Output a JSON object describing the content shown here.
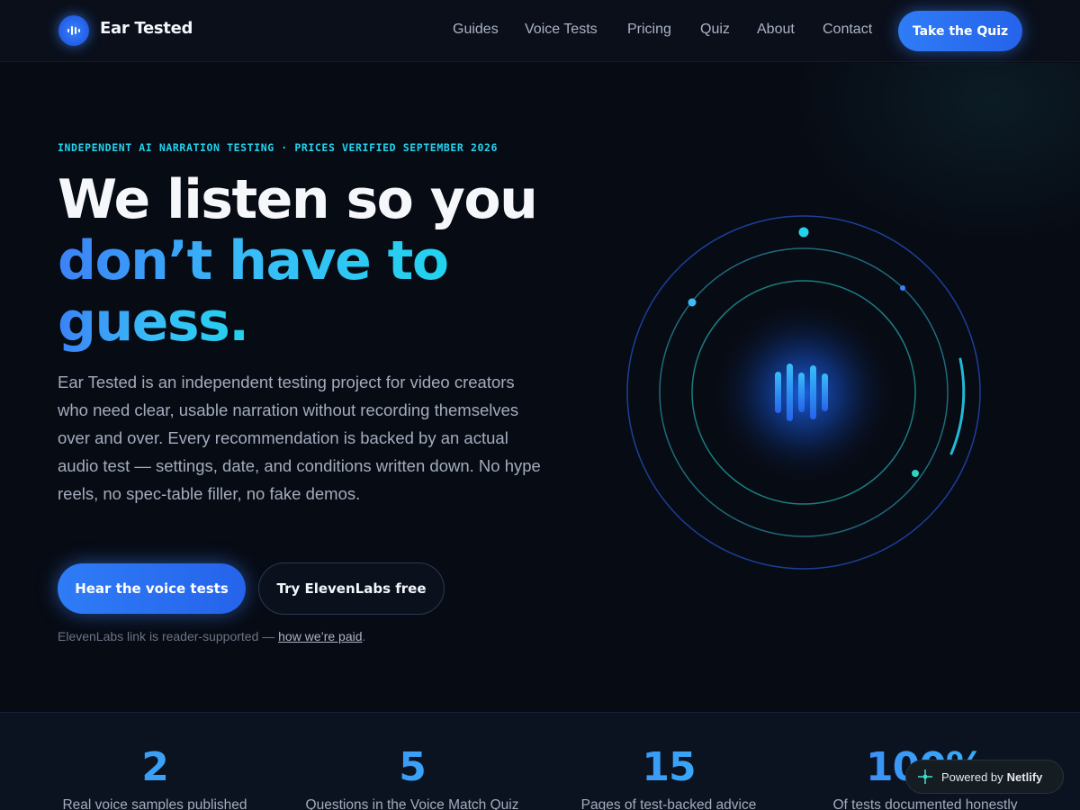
{
  "header": {
    "brand": "Ear Tested",
    "nav": [
      "Guides",
      "Voice Tests",
      "Pricing",
      "Quiz",
      "About",
      "Contact"
    ],
    "cta": "Take the Quiz"
  },
  "hero": {
    "eyebrow": "INDEPENDENT AI NARRATION TESTING · PRICES VERIFIED SEPTEMBER 2026",
    "headline_line1": "We listen so you",
    "headline_line2": "don’t have to",
    "headline_line3": "guess.",
    "lede": "Ear Tested is an independent testing project for video creators who need clear, usable narration without recording themselves over and over. Every recommendation is backed by an actual audio test — settings, date, and conditions written down. No hype reels, no spec-table filler, no fake demos.",
    "primary_button": "Hear the voice tests",
    "secondary_button": "Try ElevenLabs free",
    "disclosure_text": "ElevenLabs link is reader-supported — ",
    "disclosure_link": "how we’re paid",
    "disclosure_end": "."
  },
  "stats": [
    {
      "value": "2",
      "label": "Real voice samples published"
    },
    {
      "value": "5",
      "label": "Questions in the Voice Match Quiz"
    },
    {
      "value": "15",
      "label": "Pages of test-backed advice"
    },
    {
      "value": "100%",
      "label": "Of tests documented honestly"
    }
  ],
  "badge": {
    "prefix": "Powered by",
    "name": "Netlify"
  },
  "colors": {
    "accent": "#2563eb",
    "cyan": "#22d3ee",
    "background": "#070b14"
  },
  "icons": {
    "logo": "waveform-icon",
    "hero": "waveform-icon",
    "badge": "netlify-icon"
  }
}
